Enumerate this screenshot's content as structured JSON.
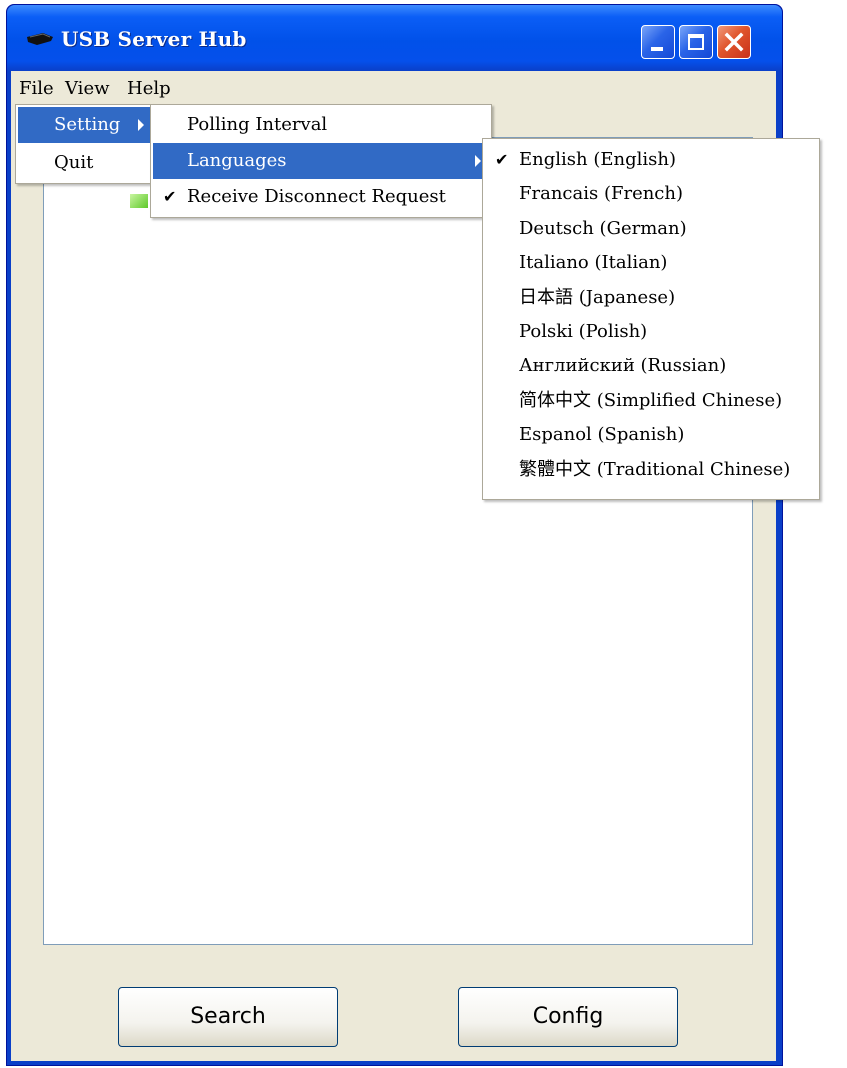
{
  "window": {
    "title": "USB Server Hub",
    "title_bar_color": "#0b5ef6",
    "icon": "app-device-icon"
  },
  "title_buttons": {
    "minimize_icon": "minimize-icon",
    "maximize_icon": "maximize-icon",
    "close_icon": "close-icon"
  },
  "menubar": {
    "items": [
      {
        "label": "File"
      },
      {
        "label": "View"
      },
      {
        "label": "Help"
      }
    ]
  },
  "file_menu": {
    "items": [
      {
        "label": "Setting",
        "has_submenu": true,
        "highlighted": true
      },
      {
        "label": "Quit"
      }
    ]
  },
  "setting_menu": {
    "items": [
      {
        "label": "Polling Interval"
      },
      {
        "label": "Languages",
        "has_submenu": true,
        "highlighted": true
      },
      {
        "label": "Receive Disconnect Request",
        "checked": true,
        "check_mark": "✔"
      }
    ]
  },
  "languages_menu": {
    "check_mark": "✔",
    "items": [
      {
        "label": "English (English)",
        "checked": true
      },
      {
        "label": "Francais (French)"
      },
      {
        "label": "Deutsch (German)"
      },
      {
        "label": "Italiano (Italian)"
      },
      {
        "label": "日本語 (Japanese)"
      },
      {
        "label": "Polski (Polish)"
      },
      {
        "label": "Английский (Russian)"
      },
      {
        "label": "简体中文 (Simplified Chinese)"
      },
      {
        "label": "Espanol (Spanish)"
      },
      {
        "label": "繁體中文 (Traditional Chinese)"
      }
    ]
  },
  "buttons": {
    "search": "Search",
    "config": "Config"
  },
  "colors": {
    "highlight": "#316ac5",
    "client_background": "#ece9d8",
    "frame": "#0a3fc8"
  }
}
